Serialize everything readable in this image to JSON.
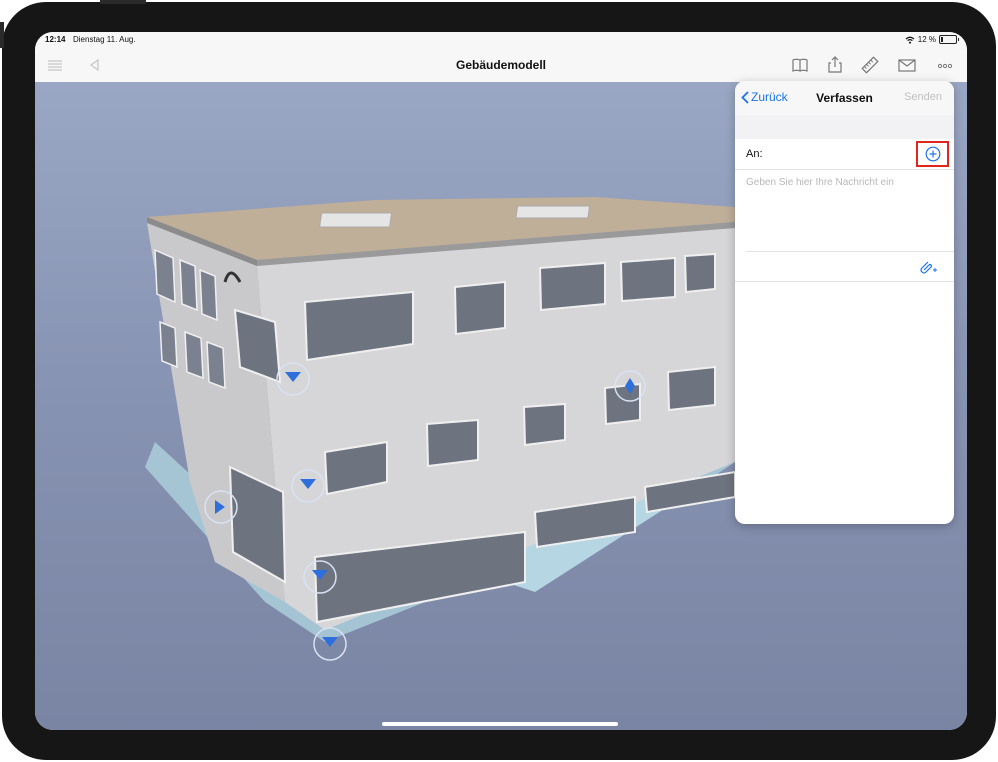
{
  "status_bar": {
    "time": "12:14",
    "date": "Dienstag 11. Aug.",
    "battery": "12 %"
  },
  "nav_bar": {
    "title": "Gebäudemodell",
    "icons": [
      "list-icon",
      "back-triangle-icon",
      "book-icon",
      "share-icon",
      "ruler-icon",
      "mail-icon",
      "more-icon"
    ]
  },
  "compose": {
    "back_label": "Zurück",
    "title": "Verfassen",
    "send_label": "Senden",
    "to_label": "An:",
    "message_placeholder": "Geben Sie hier Ihre Nachricht ein"
  },
  "colors": {
    "accent": "#1a73e8",
    "highlight": "#e0271c",
    "sky_top": "#9aa7c4",
    "marker": "#2f6fdc"
  }
}
